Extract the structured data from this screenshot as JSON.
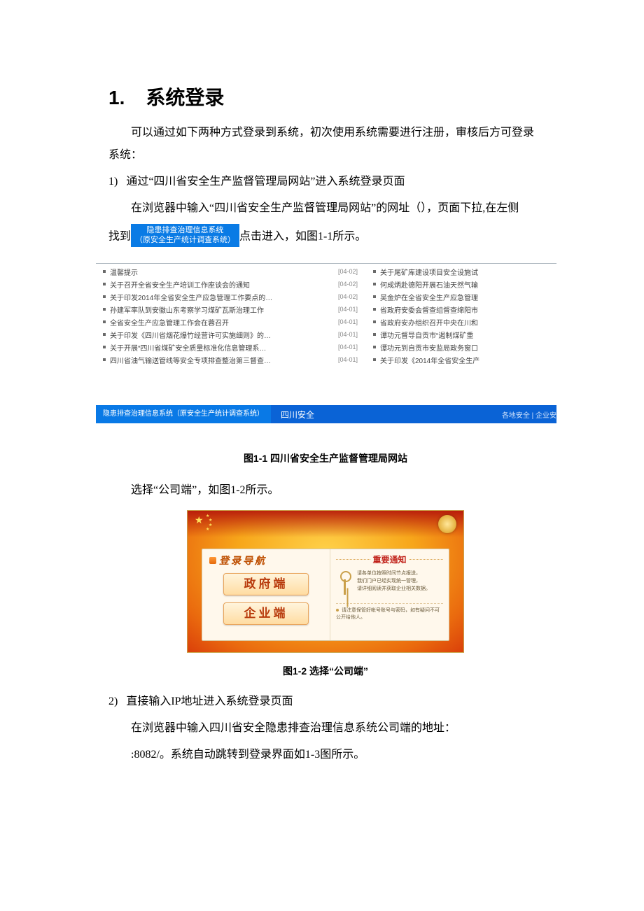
{
  "heading": {
    "num": "1.",
    "title": "系统登录"
  },
  "p_intro": "可以通过如下两种方式登录到系统，初次使用系统需要进行注册，审核后方可登录系统：",
  "step1": {
    "num": "1)",
    "title": "通过“四川省安全生产监督管理局网站”进入系统登录页面",
    "p1": "在浏览器中输入“四川省安全生产监督管理局网站”的网址（），页面下拉,在左侧",
    "p2a": "找到",
    "p2b": "点击进入，如图1-1所示。"
  },
  "badge": {
    "line1": "隐患排查治理信息系统",
    "line2": "（原安全生产统计调查系统）"
  },
  "shot1": {
    "left": [
      {
        "t": "温馨提示",
        "d": "[04-02]"
      },
      {
        "t": "关于召开全省安全生产培训工作座谈会的通知",
        "d": "[04-02]"
      },
      {
        "t": "关于印发2014年全省安全生产应急管理工作要点的…",
        "d": "[04-02]"
      },
      {
        "t": "孙建军率队到安徽山东考察学习煤矿瓦斯治理工作",
        "d": "[04-01]"
      },
      {
        "t": "全省安全生产应急管理工作会在蓉召开",
        "d": "[04-01]"
      },
      {
        "t": "关于印发《四川省烟花爆竹经营许可实施细则》的…",
        "d": "[04-01]"
      },
      {
        "t": "关于开展“四川省煤矿安全质量标准化信息管理系…",
        "d": "[04-01]"
      },
      {
        "t": "四川省油气输送管线等安全专项排查整治第三督查…",
        "d": "[04-01]"
      }
    ],
    "right": [
      {
        "t": "关于尾矿库建设项目安全设施试"
      },
      {
        "t": "何成炳赴德阳开展石油天然气输"
      },
      {
        "t": "吴金炉在全省安全生产应急管理"
      },
      {
        "t": "省政府安委会督查组督查绵阳市"
      },
      {
        "t": "省政府安办组织召开中央在川和"
      },
      {
        "t": "谭功元督导自贡市“遏制煤矿重"
      },
      {
        "t": "谭功元到自贡市安监局政务窗口"
      },
      {
        "t": "关于印发《2014年全省安全生产"
      }
    ],
    "bar": {
      "cell1_line1": "隐患排查治理信息系统",
      "cell1_line2": "（原安全生产统计调查系统）",
      "tab2": "四川安全",
      "right": "各地安全 | 企业安"
    }
  },
  "caption1": "图1-1 四川省安全生产监督管理局网站",
  "p_choose": "选择“公司端”，如图1-2所示。",
  "shot2": {
    "left_title": "登录导航",
    "btn_gov": "政府端",
    "btn_ent": "企业端",
    "right_title": "重要通知",
    "note1_line1": "请各单位按照时间节点报送，",
    "note1_line2": "我们门户已经实现统一管理，",
    "note1_line3": "请详细阅读并获取企业相关数据。",
    "note2": "请注意保管好帐号账号与密码，如有疑问不可公开给他人。"
  },
  "caption2": "图1-2 选择“公司端”",
  "step2": {
    "num": "2)",
    "title": "直接输入IP地址进入系统登录页面",
    "p1": "在浏览器中输入四川省安全隐患排查治理信息系统公司端的地址：",
    "p2": ":8082/。系统自动跳转到登录界面如1-3图所示。"
  }
}
